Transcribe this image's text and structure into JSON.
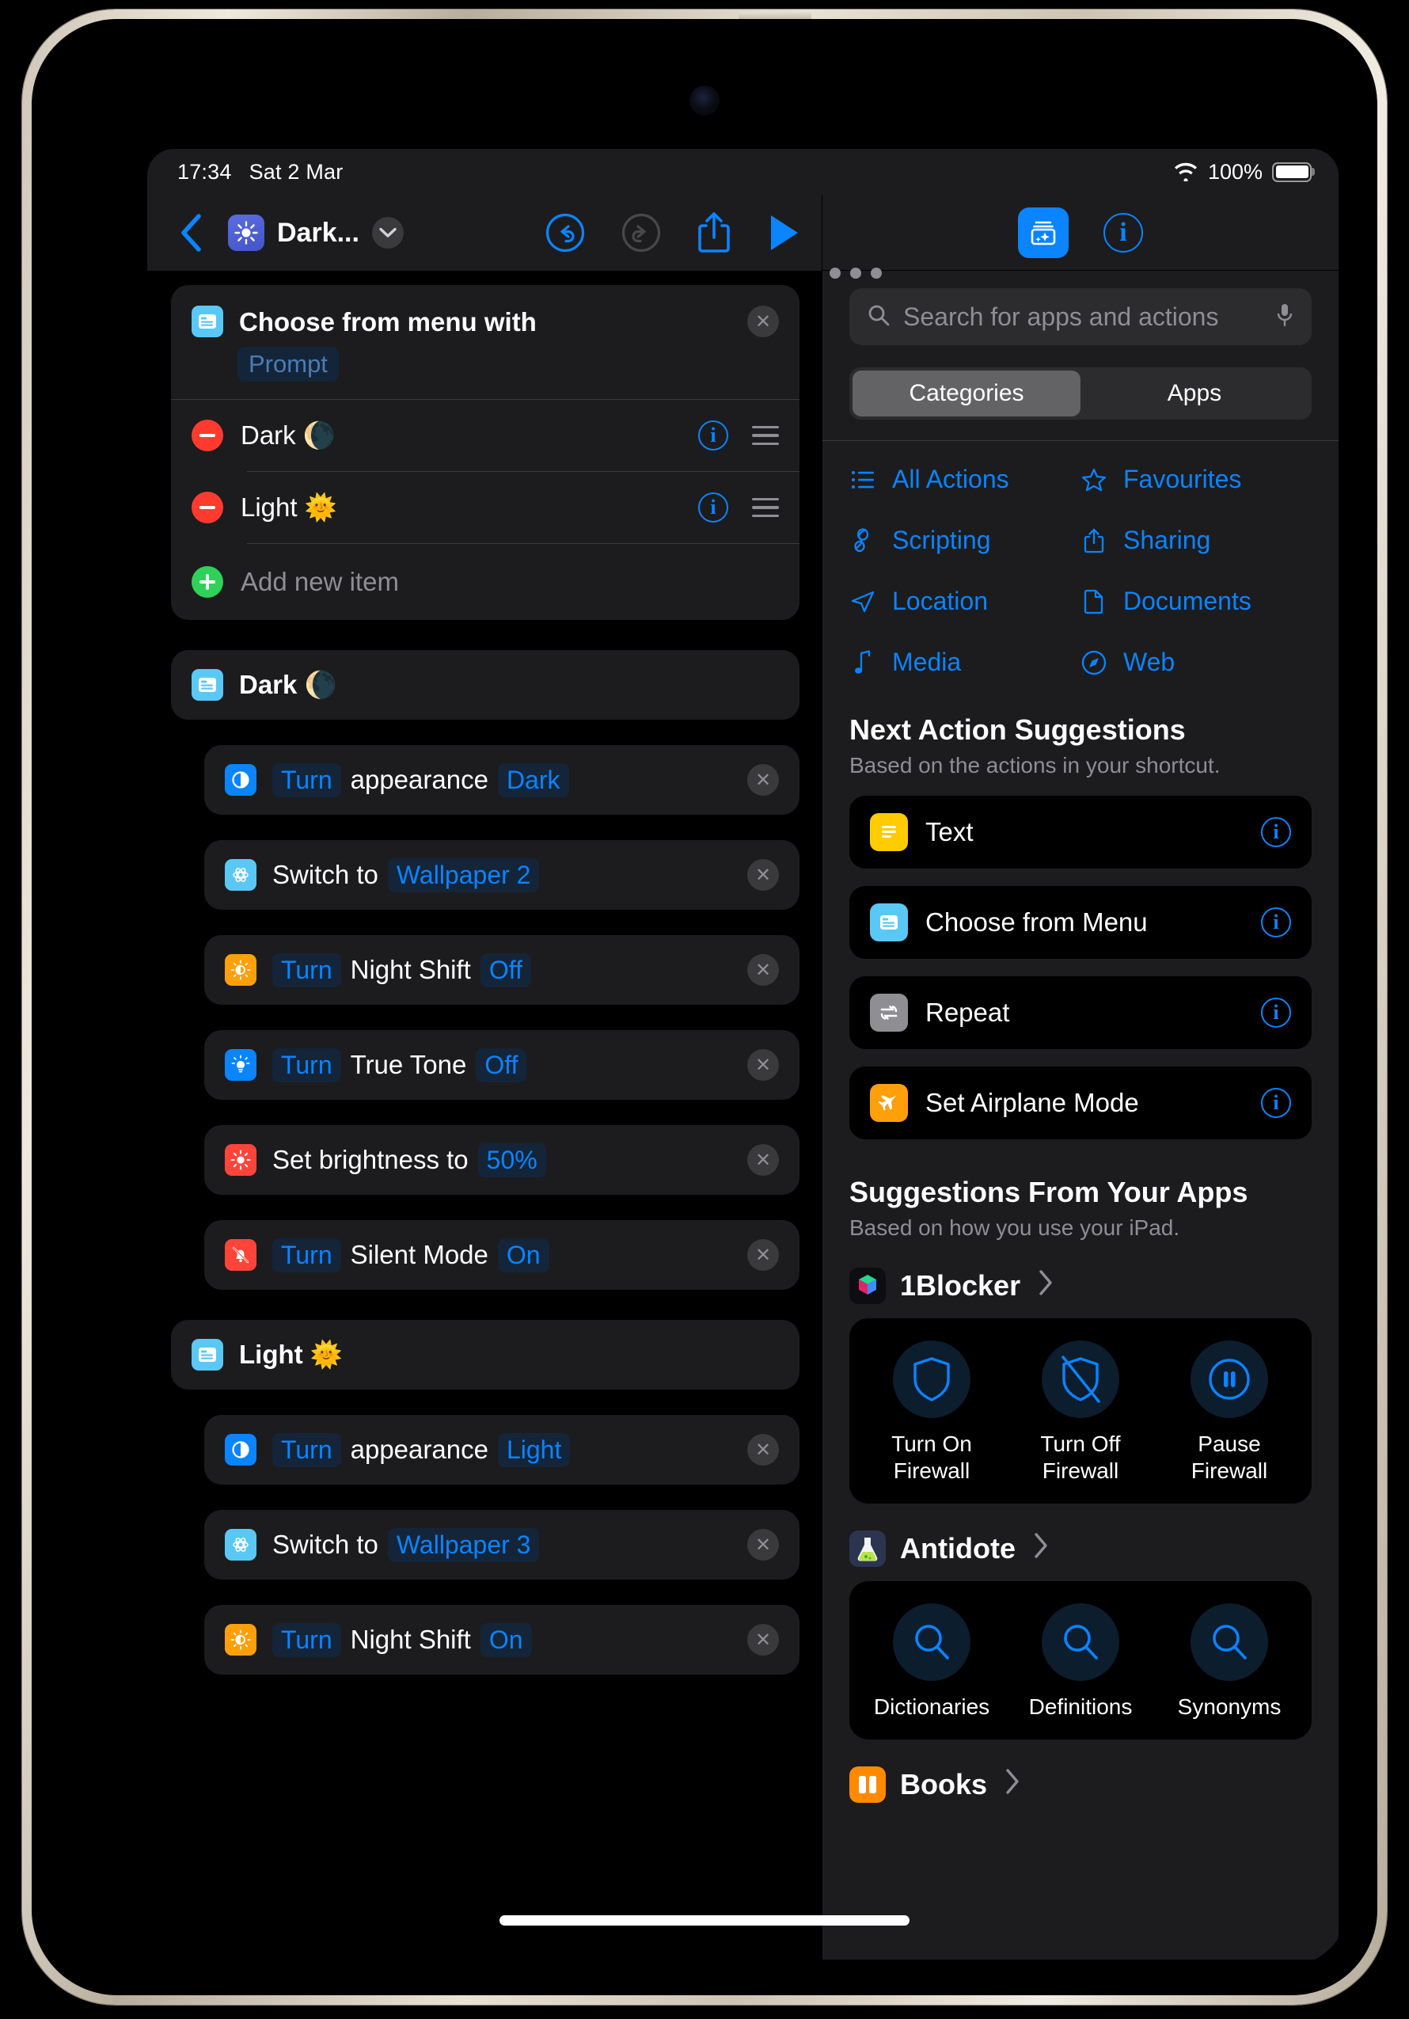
{
  "status_bar": {
    "time": "17:34",
    "date": "Sat 2 Mar",
    "battery_percent": "100%",
    "wifi_icon": "wifi-icon",
    "battery_icon": "battery-full-icon"
  },
  "editor_toolbar": {
    "back_icon": "chevron-left-icon",
    "shortcut_icon": "brightness-sun-icon",
    "title": "Dark...",
    "title_chevron_icon": "chevron-down-icon",
    "undo_icon": "undo-arrow-icon",
    "redo_icon": "redo-arrow-icon",
    "share_icon": "share-up-icon",
    "play_icon": "play-triangle-icon",
    "more_icon": "ellipsis-icon"
  },
  "menu_action": {
    "icon": "choose-from-menu-icon",
    "title": "Choose from menu with",
    "prompt_token": "Prompt",
    "close_icon": "close-x-icon",
    "items": [
      {
        "label": "Dark 🌘",
        "remove_icon": "minus-circle-icon",
        "info_icon": "info-circle-icon",
        "grip_icon": "reorder-grip-icon"
      },
      {
        "label": "Light 🌞",
        "remove_icon": "minus-circle-icon",
        "info_icon": "info-circle-icon",
        "grip_icon": "reorder-grip-icon"
      }
    ],
    "add_new_label": "Add new item",
    "add_icon": "plus-circle-icon"
  },
  "branches": [
    {
      "group_label": "Dark 🌘",
      "group_icon": "choose-from-menu-icon",
      "actions": [
        {
          "icon": "appearance-icon",
          "icon_class": "ic-appearance",
          "parts": [
            {
              "t": "tok",
              "v": "Turn"
            },
            {
              "t": "plain",
              "v": "appearance"
            },
            {
              "t": "tok",
              "v": "Dark"
            }
          ],
          "close_icon": "close-x-icon"
        },
        {
          "icon": "wallpaper-icon",
          "icon_class": "ic-wallpaper",
          "parts": [
            {
              "t": "plain",
              "v": "Switch to"
            },
            {
              "t": "tok",
              "v": "Wallpaper 2"
            }
          ],
          "close_icon": "close-x-icon"
        },
        {
          "icon": "night-shift-icon",
          "icon_class": "ic-nightshift",
          "parts": [
            {
              "t": "tok",
              "v": "Turn"
            },
            {
              "t": "plain",
              "v": "Night Shift"
            },
            {
              "t": "tok",
              "v": "Off"
            }
          ],
          "close_icon": "close-x-icon"
        },
        {
          "icon": "true-tone-icon",
          "icon_class": "ic-truetone",
          "parts": [
            {
              "t": "tok",
              "v": "Turn"
            },
            {
              "t": "plain",
              "v": "True Tone"
            },
            {
              "t": "tok",
              "v": "Off"
            }
          ],
          "close_icon": "close-x-icon"
        },
        {
          "icon": "brightness-icon",
          "icon_class": "ic-brightness",
          "parts": [
            {
              "t": "plain",
              "v": "Set brightness to"
            },
            {
              "t": "tok",
              "v": "50%"
            }
          ],
          "close_icon": "close-x-icon"
        },
        {
          "icon": "silent-mode-icon",
          "icon_class": "ic-silent",
          "parts": [
            {
              "t": "tok",
              "v": "Turn"
            },
            {
              "t": "plain",
              "v": "Silent Mode"
            },
            {
              "t": "tok",
              "v": "On"
            }
          ],
          "close_icon": "close-x-icon"
        }
      ]
    },
    {
      "group_label": "Light 🌞",
      "group_icon": "choose-from-menu-icon",
      "actions": [
        {
          "icon": "appearance-icon",
          "icon_class": "ic-appearance",
          "parts": [
            {
              "t": "tok",
              "v": "Turn"
            },
            {
              "t": "plain",
              "v": "appearance"
            },
            {
              "t": "tok",
              "v": "Light"
            }
          ],
          "close_icon": "close-x-icon"
        },
        {
          "icon": "wallpaper-icon",
          "icon_class": "ic-wallpaper",
          "parts": [
            {
              "t": "plain",
              "v": "Switch to"
            },
            {
              "t": "tok",
              "v": "Wallpaper 3"
            }
          ],
          "close_icon": "close-x-icon"
        },
        {
          "icon": "night-shift-icon",
          "icon_class": "ic-nightshift",
          "parts": [
            {
              "t": "tok",
              "v": "Turn"
            },
            {
              "t": "plain",
              "v": "Night Shift"
            },
            {
              "t": "tok",
              "v": "On"
            }
          ],
          "close_icon": "close-x-icon"
        }
      ]
    }
  ],
  "library": {
    "add_icon": "add-to-shortcut-icon",
    "info_icon": "info-circle-icon",
    "search": {
      "placeholder": "Search for apps and actions",
      "search_icon": "search-icon",
      "mic_icon": "microphone-icon"
    },
    "segments": [
      {
        "label": "Categories",
        "active": true
      },
      {
        "label": "Apps",
        "active": false
      }
    ],
    "categories": [
      {
        "label": "All Actions",
        "icon": "list-bullet-icon"
      },
      {
        "label": "Favourites",
        "icon": "star-icon"
      },
      {
        "label": "Scripting",
        "icon": "scripting-icon"
      },
      {
        "label": "Sharing",
        "icon": "share-up-icon"
      },
      {
        "label": "Location",
        "icon": "location-arrow-icon"
      },
      {
        "label": "Documents",
        "icon": "document-page-icon"
      },
      {
        "label": "Media",
        "icon": "music-note-icon"
      },
      {
        "label": "Web",
        "icon": "safari-compass-icon"
      }
    ],
    "next_actions": {
      "title": "Next Action Suggestions",
      "subtitle": "Based on the actions in your shortcut.",
      "items": [
        {
          "label": "Text",
          "icon": "text-lines-icon",
          "icon_class": "ic-text",
          "info_icon": "info-circle-icon"
        },
        {
          "label": "Choose from Menu",
          "icon": "choose-from-menu-icon",
          "icon_class": "ic-cfm",
          "info_icon": "info-circle-icon"
        },
        {
          "label": "Repeat",
          "icon": "repeat-arrows-icon",
          "icon_class": "ic-repeat",
          "info_icon": "info-circle-icon"
        },
        {
          "label": "Set Airplane Mode",
          "icon": "airplane-icon",
          "icon_class": "ic-airplane",
          "info_icon": "info-circle-icon"
        }
      ]
    },
    "app_suggestions": {
      "title": "Suggestions From Your Apps",
      "subtitle": "Based on how you use your iPad.",
      "apps": [
        {
          "name": "1Blocker",
          "app_icon": "oneblocker-cube-icon",
          "chevron_icon": "chevron-right-icon",
          "actions": [
            {
              "label": "Turn On\nFirewall",
              "icon": "shield-icon"
            },
            {
              "label": "Turn Off\nFirewall",
              "icon": "shield-slash-icon"
            },
            {
              "label": "Pause\nFirewall",
              "icon": "pause-circle-icon"
            }
          ]
        },
        {
          "name": "Antidote",
          "app_icon": "antidote-flask-icon",
          "chevron_icon": "chevron-right-icon",
          "actions": [
            {
              "label": "Dictionaries",
              "icon": "search-icon"
            },
            {
              "label": "Definitions",
              "icon": "search-icon"
            },
            {
              "label": "Synonyms",
              "icon": "search-icon"
            }
          ]
        },
        {
          "name": "Books",
          "app_icon": "books-icon",
          "chevron_icon": "chevron-right-icon",
          "actions": []
        }
      ]
    }
  },
  "colors": {
    "accent_blue": "#0a84ff",
    "panel": "#1c1c1e",
    "card": "#1c1c1e",
    "token_bg": "#14253a",
    "red": "#ff3b30",
    "green": "#30d158",
    "orange": "#ff9f0a",
    "yellow": "#ffcc00",
    "cyan": "#5ac8f5"
  }
}
